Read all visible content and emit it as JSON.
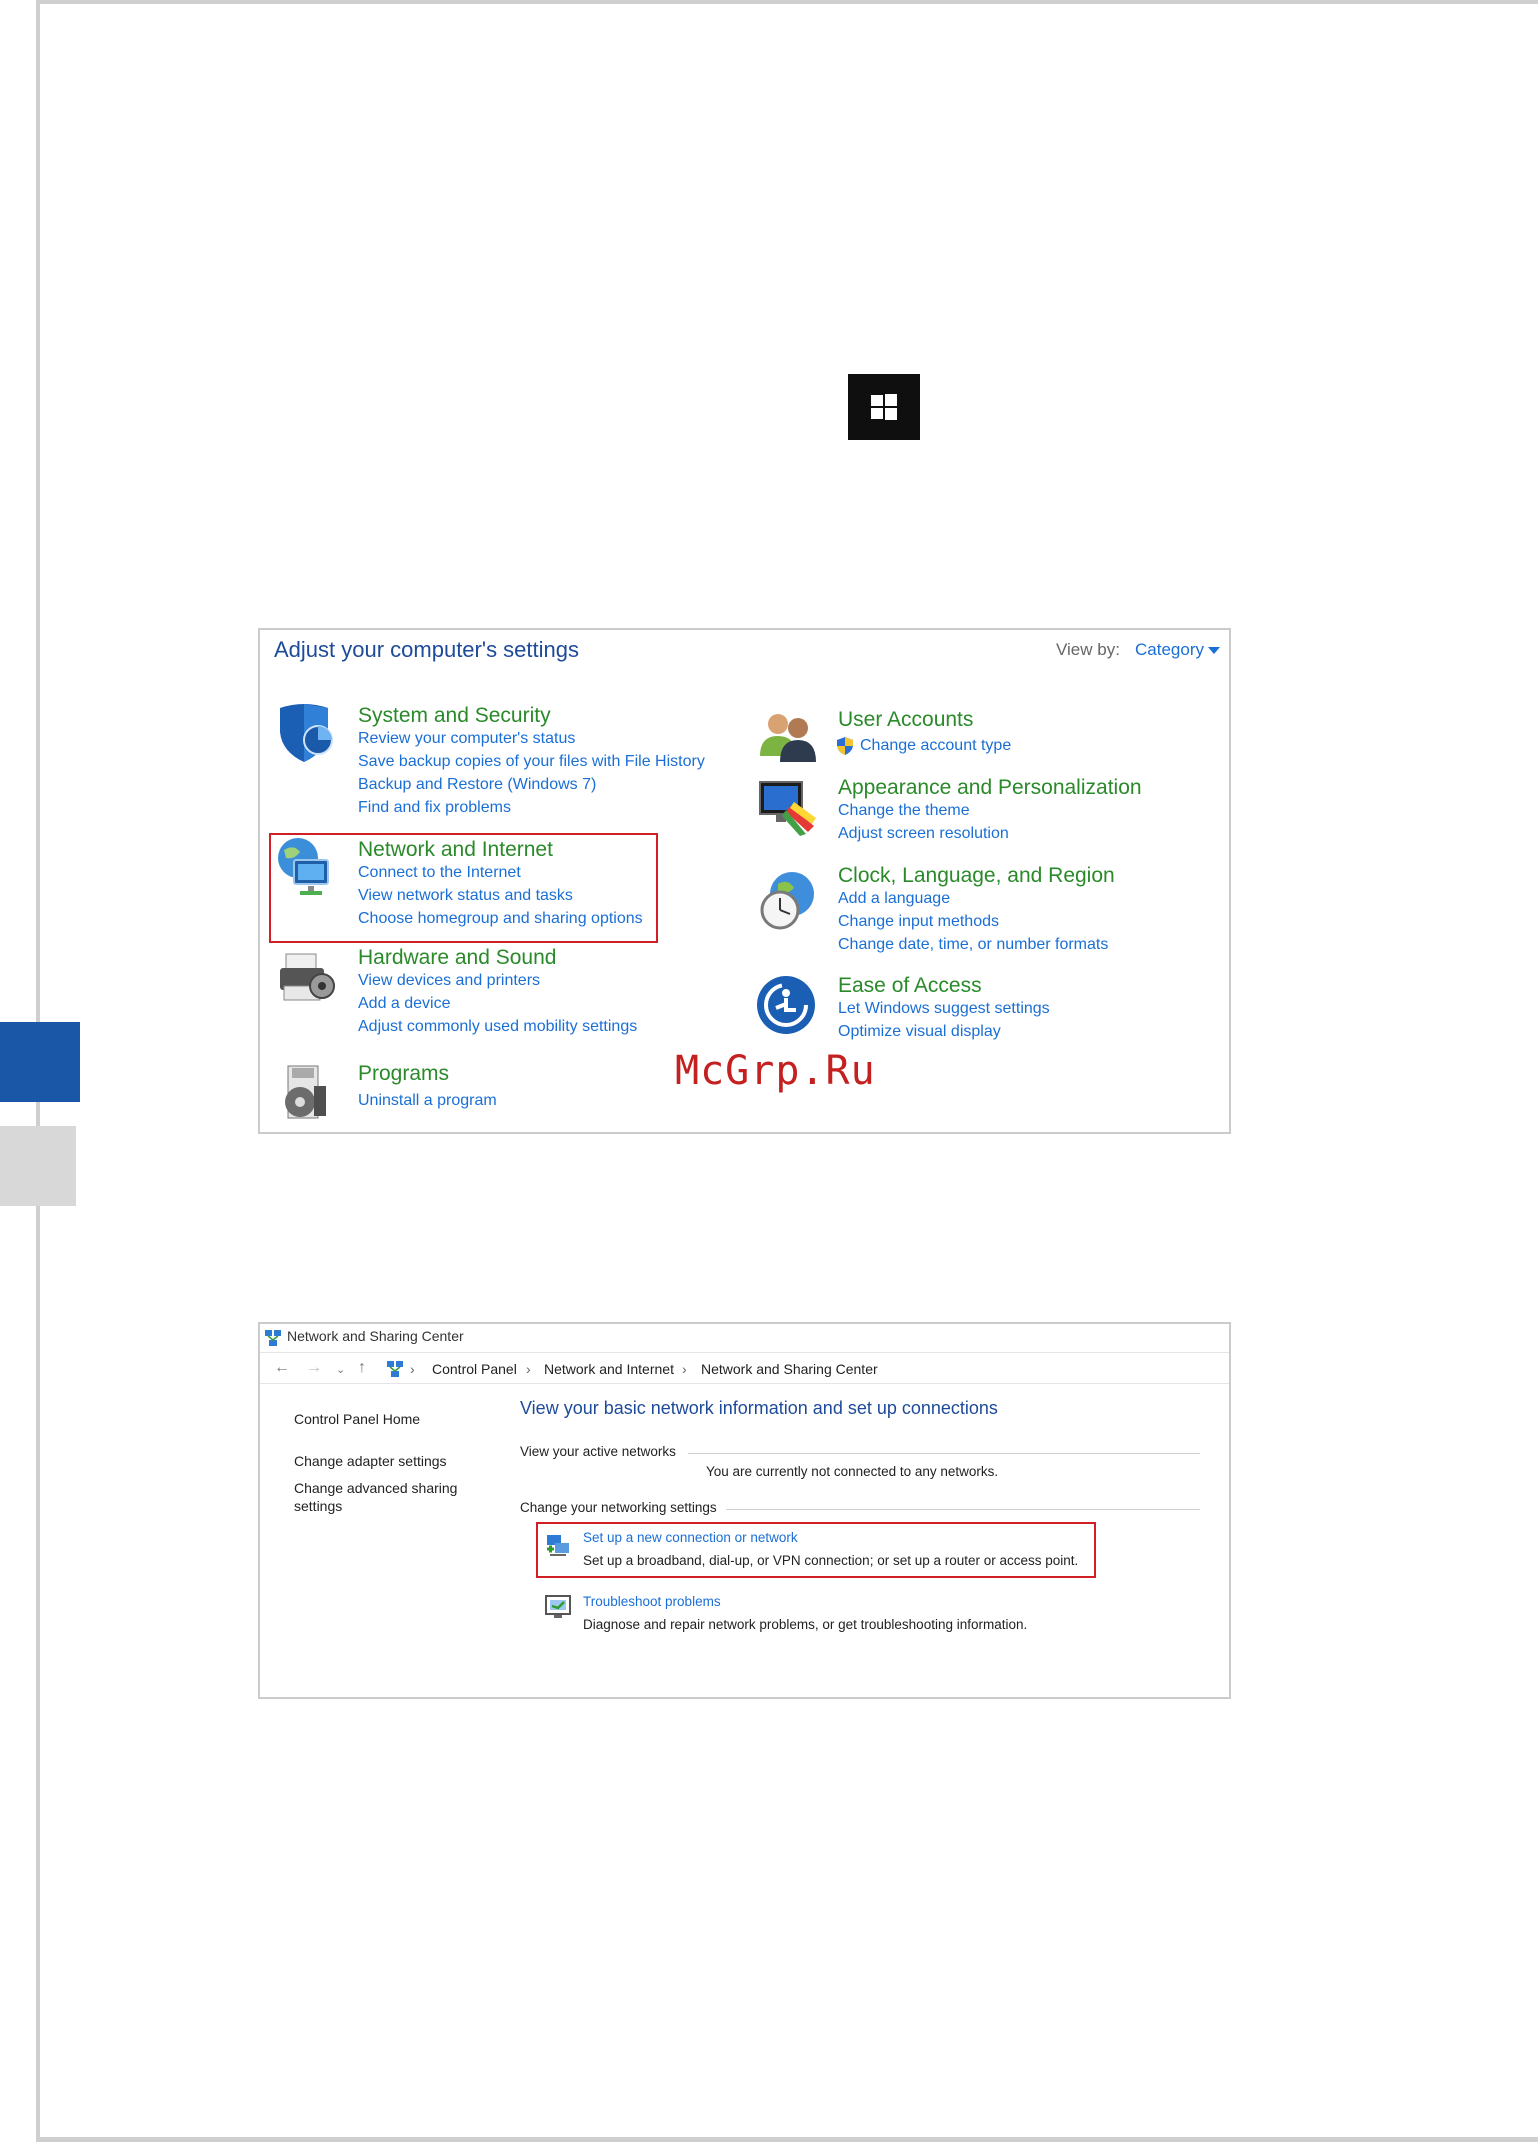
{
  "control_panel": {
    "title": "Adjust your computer's settings",
    "view_by_label": "View by:",
    "view_by_value": "Category",
    "left_categories": [
      {
        "head": "System and Security",
        "links": [
          "Review your computer's status",
          "Save backup copies of your files with File History",
          "Backup and Restore (Windows 7)",
          "Find and fix problems"
        ],
        "icon": "shield-icon"
      },
      {
        "head": "Network and Internet",
        "links": [
          "Connect to the Internet",
          "View network status and tasks",
          "Choose homegroup and sharing options"
        ],
        "icon": "network-globe-icon",
        "highlighted": true
      },
      {
        "head": "Hardware and Sound",
        "links": [
          "View devices and printers",
          "Add a device",
          "Adjust commonly used mobility settings"
        ],
        "icon": "printer-icon"
      },
      {
        "head": "Programs",
        "links": [
          "Uninstall a program"
        ],
        "icon": "programs-disc-icon"
      }
    ],
    "right_categories": [
      {
        "head": "User Accounts",
        "links": [
          "Change account type"
        ],
        "icon": "users-icon"
      },
      {
        "head": "Appearance and Personalization",
        "links": [
          "Change the theme",
          "Adjust screen resolution"
        ],
        "icon": "monitor-palette-icon"
      },
      {
        "head": "Clock, Language, and Region",
        "links": [
          "Add a language",
          "Change input methods",
          "Change date, time, or number formats"
        ],
        "icon": "clock-globe-icon"
      },
      {
        "head": "Ease of Access",
        "links": [
          "Let Windows suggest settings",
          "Optimize visual display"
        ],
        "icon": "ease-of-access-icon"
      }
    ]
  },
  "watermark": "McGrp.Ru",
  "network_center": {
    "window_title": "Network and Sharing Center",
    "breadcrumb": [
      "Control Panel",
      "Network and Internet",
      "Network and Sharing Center"
    ],
    "sidebar": [
      "Control Panel Home",
      "Change adapter settings",
      "Change advanced sharing settings"
    ],
    "main_title": "View your basic network information and set up connections",
    "active_networks_label": "View your active networks",
    "not_connected": "You are currently not connected to any networks.",
    "change_settings_label": "Change your networking settings",
    "setup_link": "Set up a new connection or network",
    "setup_desc": "Set up a broadband, dial-up, or VPN connection; or set up a router or access point.",
    "troubleshoot_link": "Troubleshoot problems",
    "troubleshoot_desc": "Diagnose and repair network problems, or get troubleshooting information."
  },
  "colors": {
    "accent_blue": "#1a57a7",
    "link": "#1a6fd6",
    "category_green": "#2a8a2a",
    "highlight_red": "#d21f26"
  }
}
